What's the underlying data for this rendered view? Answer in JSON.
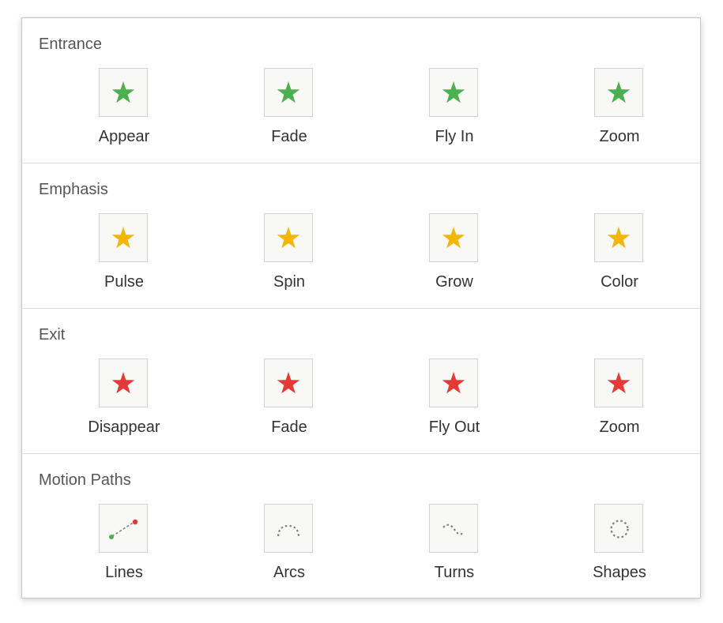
{
  "colors": {
    "entrance": "#4caf50",
    "emphasis": "#f2b705",
    "exit": "#e53935",
    "path_gray": "#808080",
    "path_start": "#4caf50",
    "path_end": "#e53935"
  },
  "sections": [
    {
      "title": "Entrance",
      "items": [
        {
          "label": "Appear",
          "icon": "green-star-icon"
        },
        {
          "label": "Fade",
          "icon": "green-star-icon"
        },
        {
          "label": "Fly In",
          "icon": "green-star-icon"
        },
        {
          "label": "Zoom",
          "icon": "green-star-icon"
        }
      ]
    },
    {
      "title": "Emphasis",
      "items": [
        {
          "label": "Pulse",
          "icon": "yellow-star-icon"
        },
        {
          "label": "Spin",
          "icon": "yellow-star-icon"
        },
        {
          "label": "Grow",
          "icon": "yellow-star-icon"
        },
        {
          "label": "Color",
          "icon": "yellow-star-icon"
        }
      ]
    },
    {
      "title": "Exit",
      "items": [
        {
          "label": "Disappear",
          "icon": "red-star-icon"
        },
        {
          "label": "Fade",
          "icon": "red-star-icon"
        },
        {
          "label": "Fly Out",
          "icon": "red-star-icon"
        },
        {
          "label": "Zoom",
          "icon": "red-star-icon"
        }
      ]
    },
    {
      "title": "Motion Paths",
      "items": [
        {
          "label": "Lines",
          "icon": "line-path-icon"
        },
        {
          "label": "Arcs",
          "icon": "arc-path-icon"
        },
        {
          "label": "Turns",
          "icon": "turn-path-icon"
        },
        {
          "label": "Shapes",
          "icon": "shape-path-icon"
        }
      ]
    }
  ]
}
